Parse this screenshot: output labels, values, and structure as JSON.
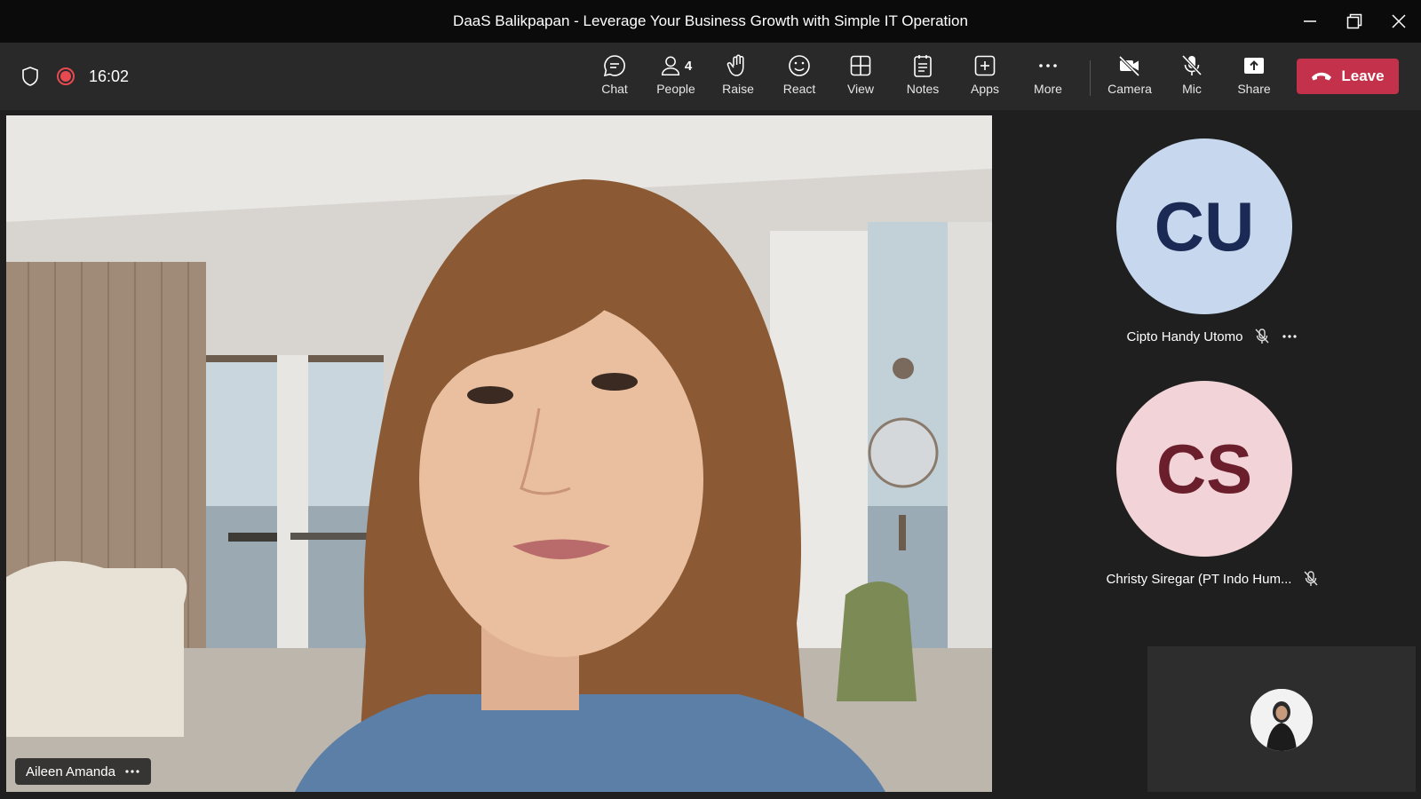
{
  "window": {
    "title": "DaaS Balikpapan - Leverage Your Business Growth with Simple IT Operation"
  },
  "toolbar": {
    "timer": "16:02",
    "buttons": [
      {
        "label": "Chat",
        "icon": "chat-icon"
      },
      {
        "label": "People",
        "icon": "people-icon",
        "badge": "4"
      },
      {
        "label": "Raise",
        "icon": "raise-hand-icon"
      },
      {
        "label": "React",
        "icon": "smile-icon"
      },
      {
        "label": "View",
        "icon": "grid-icon"
      },
      {
        "label": "Notes",
        "icon": "notes-icon"
      },
      {
        "label": "Apps",
        "icon": "plus-square-icon"
      },
      {
        "label": "More",
        "icon": "more-icon"
      },
      {
        "label": "Camera",
        "icon": "camera-off-icon"
      },
      {
        "label": "Mic",
        "icon": "mic-off-icon"
      },
      {
        "label": "Share",
        "icon": "share-icon"
      }
    ],
    "leave_label": "Leave"
  },
  "main_video": {
    "participant_name": "Aileen Amanda"
  },
  "participants": [
    {
      "initials": "CU",
      "name": "Cipto Handy Utomo",
      "avatar_bg": "#c7d7ed",
      "initials_color": "#1b2a55"
    },
    {
      "initials": "CS",
      "name": "Christy Siregar (PT Indo Hum...",
      "avatar_bg": "#f2d3d8",
      "initials_color": "#6b1e2b"
    }
  ],
  "colors": {
    "leave": "#c4314b",
    "record": "#e64a50",
    "titlebar": "#0b0b0b",
    "toolbar": "#292929"
  }
}
